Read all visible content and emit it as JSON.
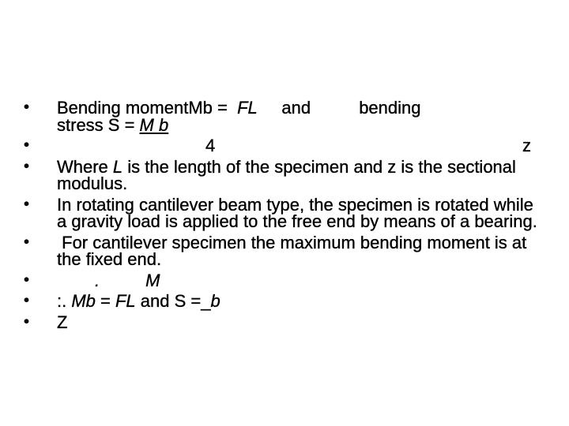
{
  "slide": {
    "bullets": [
      {
        "id": "bending-moment",
        "line1": {
          "prefix": "Bending moment",
          "mb": "Mb = ",
          "fl": "FL",
          "gap1": "     ",
          "and": "and",
          "gap2": "          ",
          "bending": "bending"
        },
        "line2": {
          "prefix": "stress S = ",
          "mb": "M b"
        }
      },
      {
        "id": "denominators",
        "left": "4",
        "right": "z"
      },
      {
        "id": "where",
        "parts": [
          "Where ",
          "L",
          " is the length of the specimen and z is the sectional modulus."
        ]
      },
      {
        "id": "rotating",
        "text": "In rotating cantilever beam type, the specimen is rotated while a gravity load is applied to the free end by means of a bearing."
      },
      {
        "id": "max-moment",
        "text": " For cantilever specimen the maximum bending moment is at the fixed end."
      },
      {
        "id": "dot-m",
        "dot": ".",
        "m": "M"
      },
      {
        "id": "therefore",
        "parts": [
          ":. ",
          "Mb",
          " = ",
          "FL",
          " and S =_",
          "b"
        ]
      },
      {
        "id": "z",
        "text": "Z"
      }
    ]
  }
}
